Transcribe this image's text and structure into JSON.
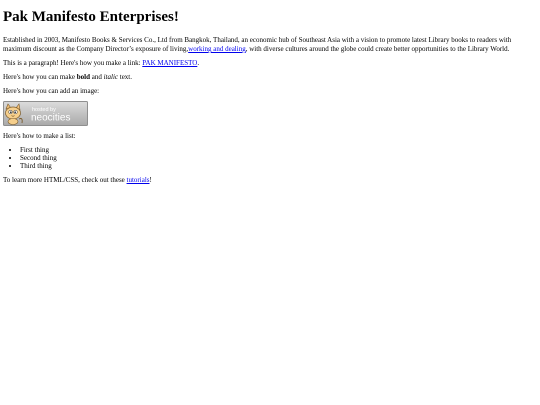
{
  "page": {
    "title": "Pak Manifesto Enterprises!",
    "intro": {
      "before_link": "Established in 2003, Manifesto Books & Services Co., Ltd from Bangkok, Thailand, an economic hub of Southeast Asia with a vision to promote latest Library books to readers with maximum discount as the Company Director’s exposure of living,",
      "link_text": "working and dealing",
      "after_link": ", with diverse cultures around the globe could create better opportunities to the Library World."
    },
    "link_paragraph": {
      "before": "This is a paragraph! Here's how you make a link: ",
      "link_text": "PAK MANIFESTO",
      "after": "."
    },
    "bold_paragraph": {
      "before": "Here's how you can make ",
      "bold_text": "bold",
      "middle": " and ",
      "italic_text": "italic",
      "after": " text."
    },
    "image_paragraph": "Here's how you can add an image:",
    "image": {
      "icon": "neocities-hosted-badge",
      "badge_top": "hosted by",
      "badge_main": "neocities"
    },
    "list_paragraph": "Here's how to make a list:",
    "list_items": [
      "First thing",
      "Second thing",
      "Third thing"
    ],
    "footer": {
      "before": "To learn more HTML/CSS, check out these ",
      "link_text": "tutorials",
      "after": "!"
    }
  }
}
